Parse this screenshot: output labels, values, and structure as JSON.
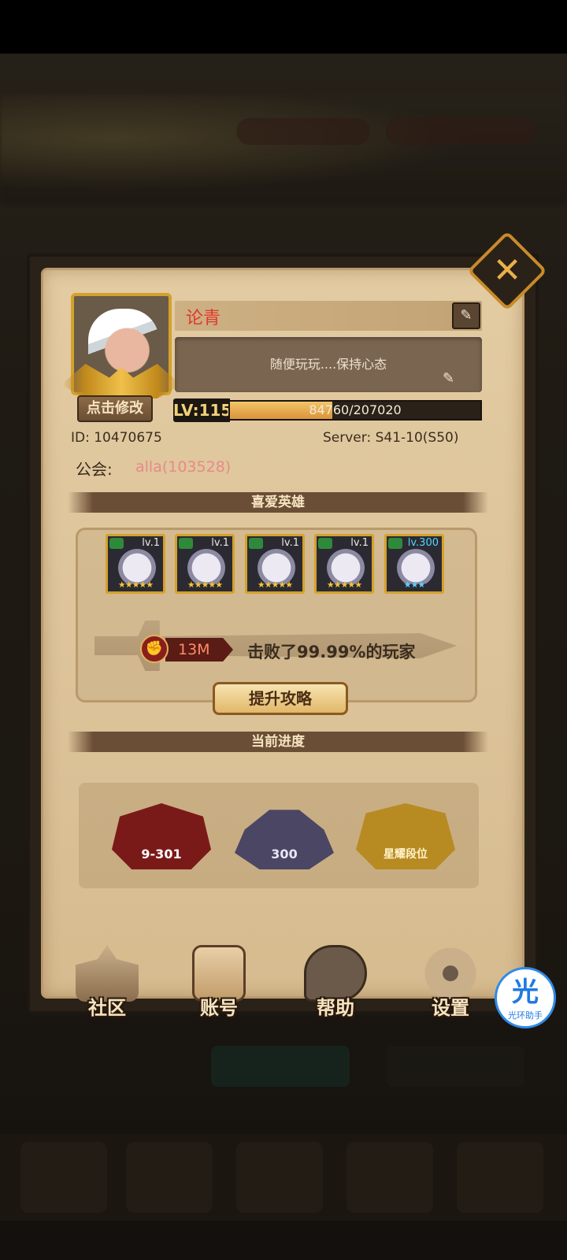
{
  "profile": {
    "name": "论青",
    "motto": "随便玩玩....保持心态",
    "edit_avatar_label": "点击修改",
    "level_label": "LV:115",
    "xp_text": "84760/207020",
    "xp_progress": 0.409,
    "id_text": "ID:  10470675",
    "server_text": "Server:  S41-10(S50)",
    "guild_label": "公会:",
    "guild_value": "alla(103528)"
  },
  "favorite_heroes": {
    "title": "喜爱英雄",
    "heroes": [
      {
        "level": "lv.1",
        "stars": "★★★★★"
      },
      {
        "level": "lv.1",
        "stars": "★★★★★"
      },
      {
        "level": "lv.1",
        "stars": "★★★★★"
      },
      {
        "level": "lv.1",
        "stars": "★★★★★"
      },
      {
        "level": "lv.300",
        "stars": "★★★"
      }
    ]
  },
  "power": {
    "value": "13M",
    "defeat_text": "击败了99.99%的玩家",
    "upgrade_button": "提升攻略"
  },
  "current_progress": {
    "title": "当前进度",
    "items": [
      {
        "label": "9-301",
        "icon": "stage-book-icon"
      },
      {
        "label": "300",
        "icon": "tower-icon"
      },
      {
        "label": "星耀段位",
        "icon": "rank-swords-icon"
      }
    ]
  },
  "bottom_buttons": [
    {
      "label": "社区",
      "icon": "castle-icon"
    },
    {
      "label": "账号",
      "icon": "account-card-icon"
    },
    {
      "label": "帮助",
      "icon": "chat-bubble-icon"
    },
    {
      "label": "设置",
      "icon": "gear-icon"
    }
  ],
  "floating_assistant": {
    "glyph": "光",
    "label": "光环助手"
  },
  "colors": {
    "parchment": "#e3cba2",
    "frame_dark": "#2a2118",
    "gold": "#d3a12c",
    "name_red": "#e0392a",
    "guild_pink": "#e78a8a"
  }
}
